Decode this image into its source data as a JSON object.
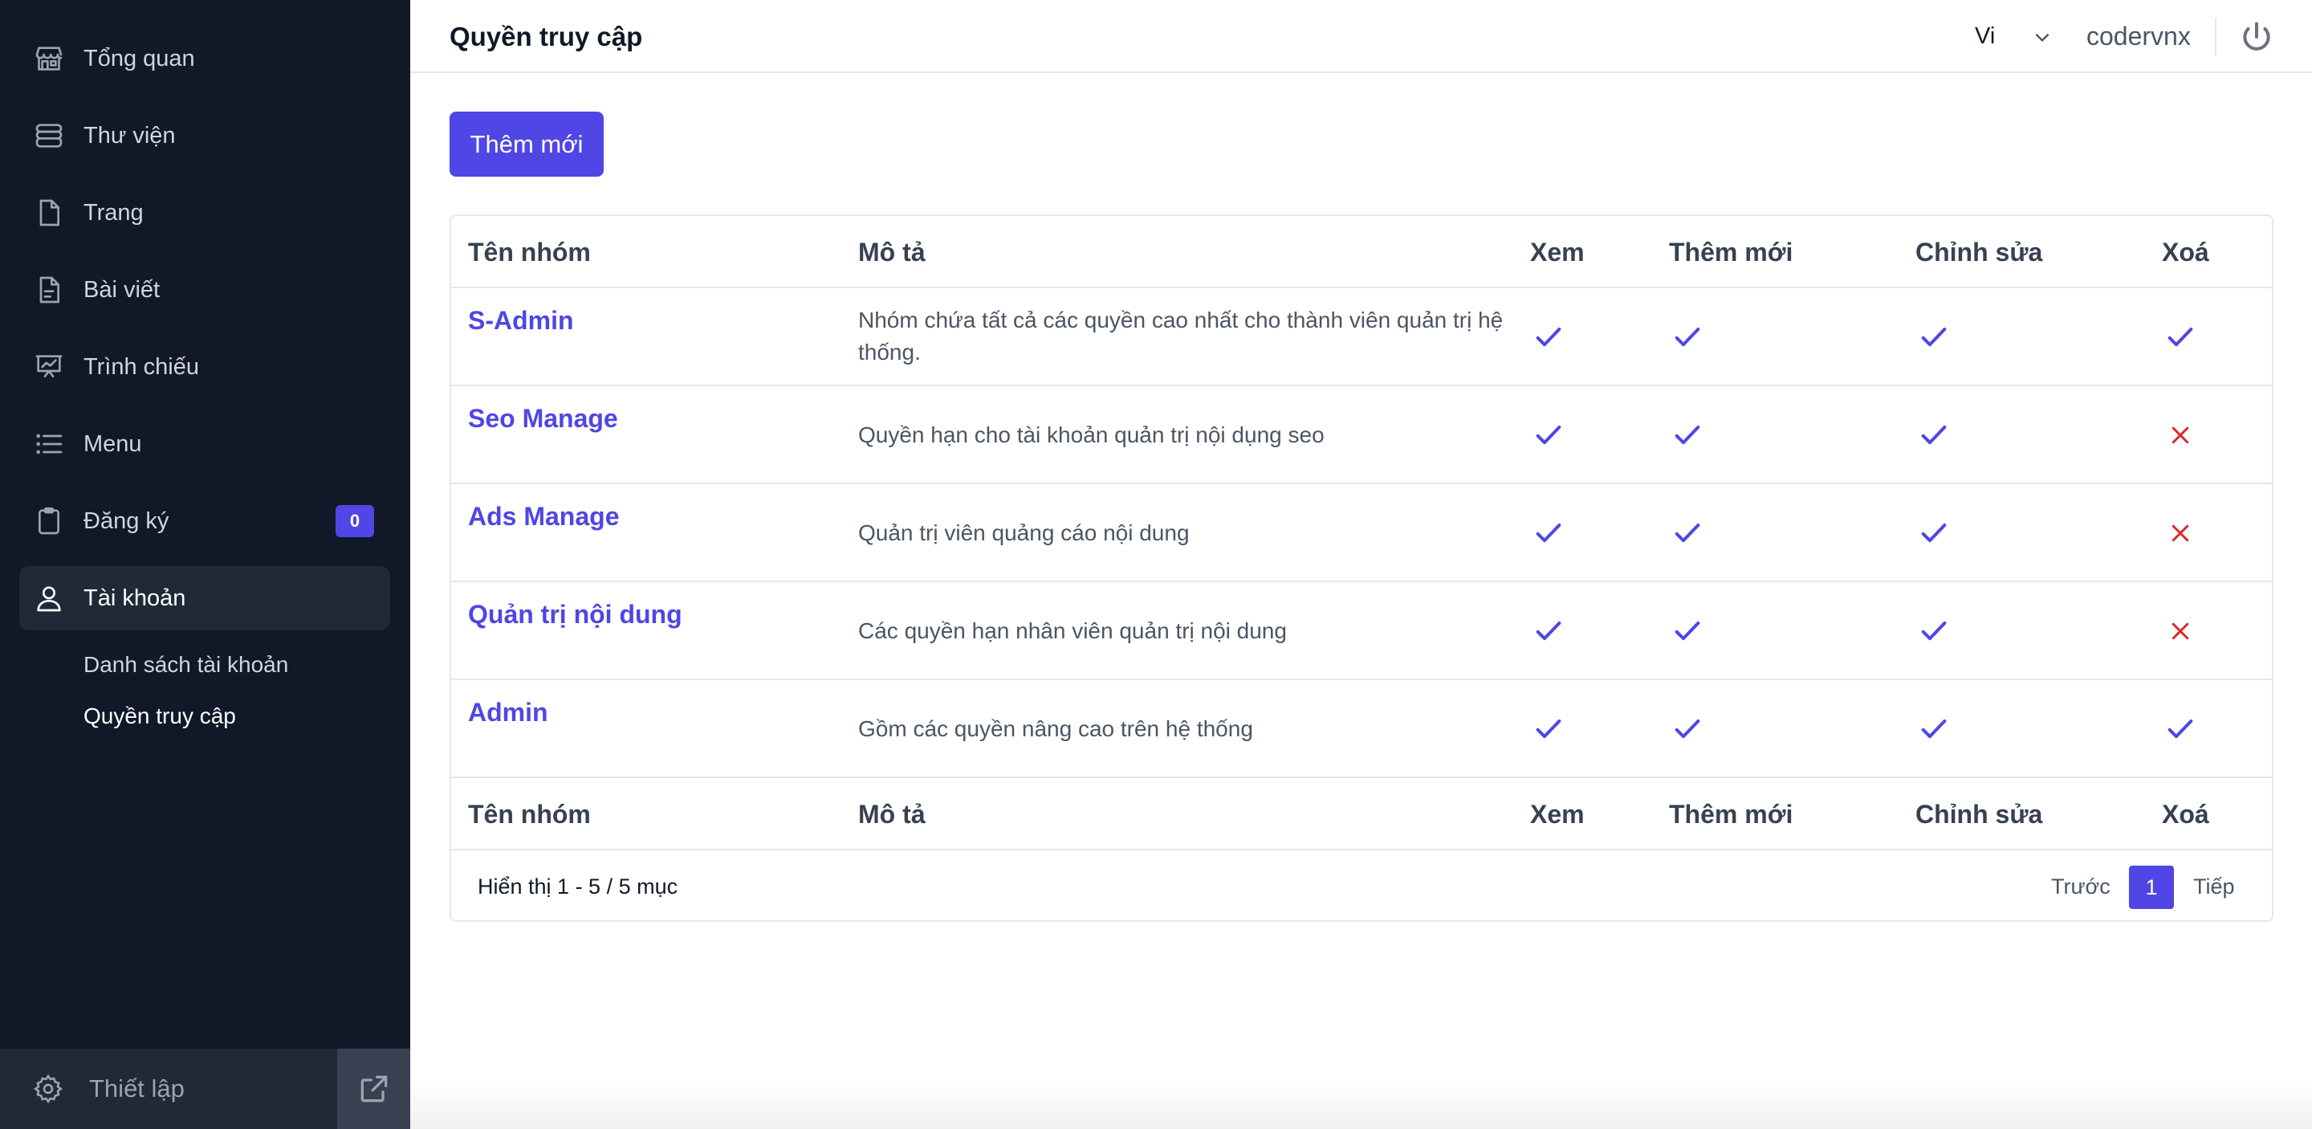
{
  "sidebar": {
    "items": [
      {
        "label": "Tổng quan",
        "icon": "store-icon"
      },
      {
        "label": "Thư viện",
        "icon": "database-icon"
      },
      {
        "label": "Trang",
        "icon": "document-icon"
      },
      {
        "label": "Bài viết",
        "icon": "document-text-icon"
      },
      {
        "label": "Trình chiếu",
        "icon": "presentation-chart-icon"
      },
      {
        "label": "Menu",
        "icon": "list-icon"
      },
      {
        "label": "Đăng ký",
        "icon": "clipboard-icon",
        "badge": "0"
      },
      {
        "label": "Tài khoản",
        "icon": "user-icon",
        "active": true
      }
    ],
    "subitems": [
      {
        "label": "Danh sách tài khoản"
      },
      {
        "label": "Quyền truy cập",
        "active": true
      }
    ],
    "settings_label": "Thiết lập"
  },
  "header": {
    "title": "Quyền truy cập",
    "language": "Vi",
    "username": "codervnx"
  },
  "main": {
    "add_button": "Thêm mới",
    "table": {
      "columns": [
        "Tên nhóm",
        "Mô tả",
        "Xem",
        "Thêm mới",
        "Chỉnh sửa",
        "Xoá"
      ],
      "rows": [
        {
          "name": "S-Admin",
          "description": "Nhóm chứa tất cả các quyền cao nhất cho thành viên quản trị hệ thống.",
          "view": true,
          "add": true,
          "edit": true,
          "delete": true
        },
        {
          "name": "Seo Manage",
          "description": "Quyền hạn cho tài khoản quản trị nội dụng seo",
          "view": true,
          "add": true,
          "edit": true,
          "delete": false
        },
        {
          "name": "Ads Manage",
          "description": "Quản trị viên quảng cáo nội dung",
          "view": true,
          "add": true,
          "edit": true,
          "delete": false
        },
        {
          "name": "Quản trị nội dung",
          "description": "Các quyền hạn nhân viên quản trị nội dung",
          "view": true,
          "add": true,
          "edit": true,
          "delete": false
        },
        {
          "name": "Admin",
          "description": "Gồm các quyền nâng cao trên hệ thống",
          "view": true,
          "add": true,
          "edit": true,
          "delete": true
        }
      ]
    },
    "pagination": {
      "summary": "Hiển thị 1 - 5 / 5 mục",
      "prev": "Trước",
      "current": "1",
      "next": "Tiếp"
    }
  },
  "colors": {
    "accent": "#4f46e5",
    "sidebar_bg": "#111827",
    "deny": "#dc2626"
  }
}
